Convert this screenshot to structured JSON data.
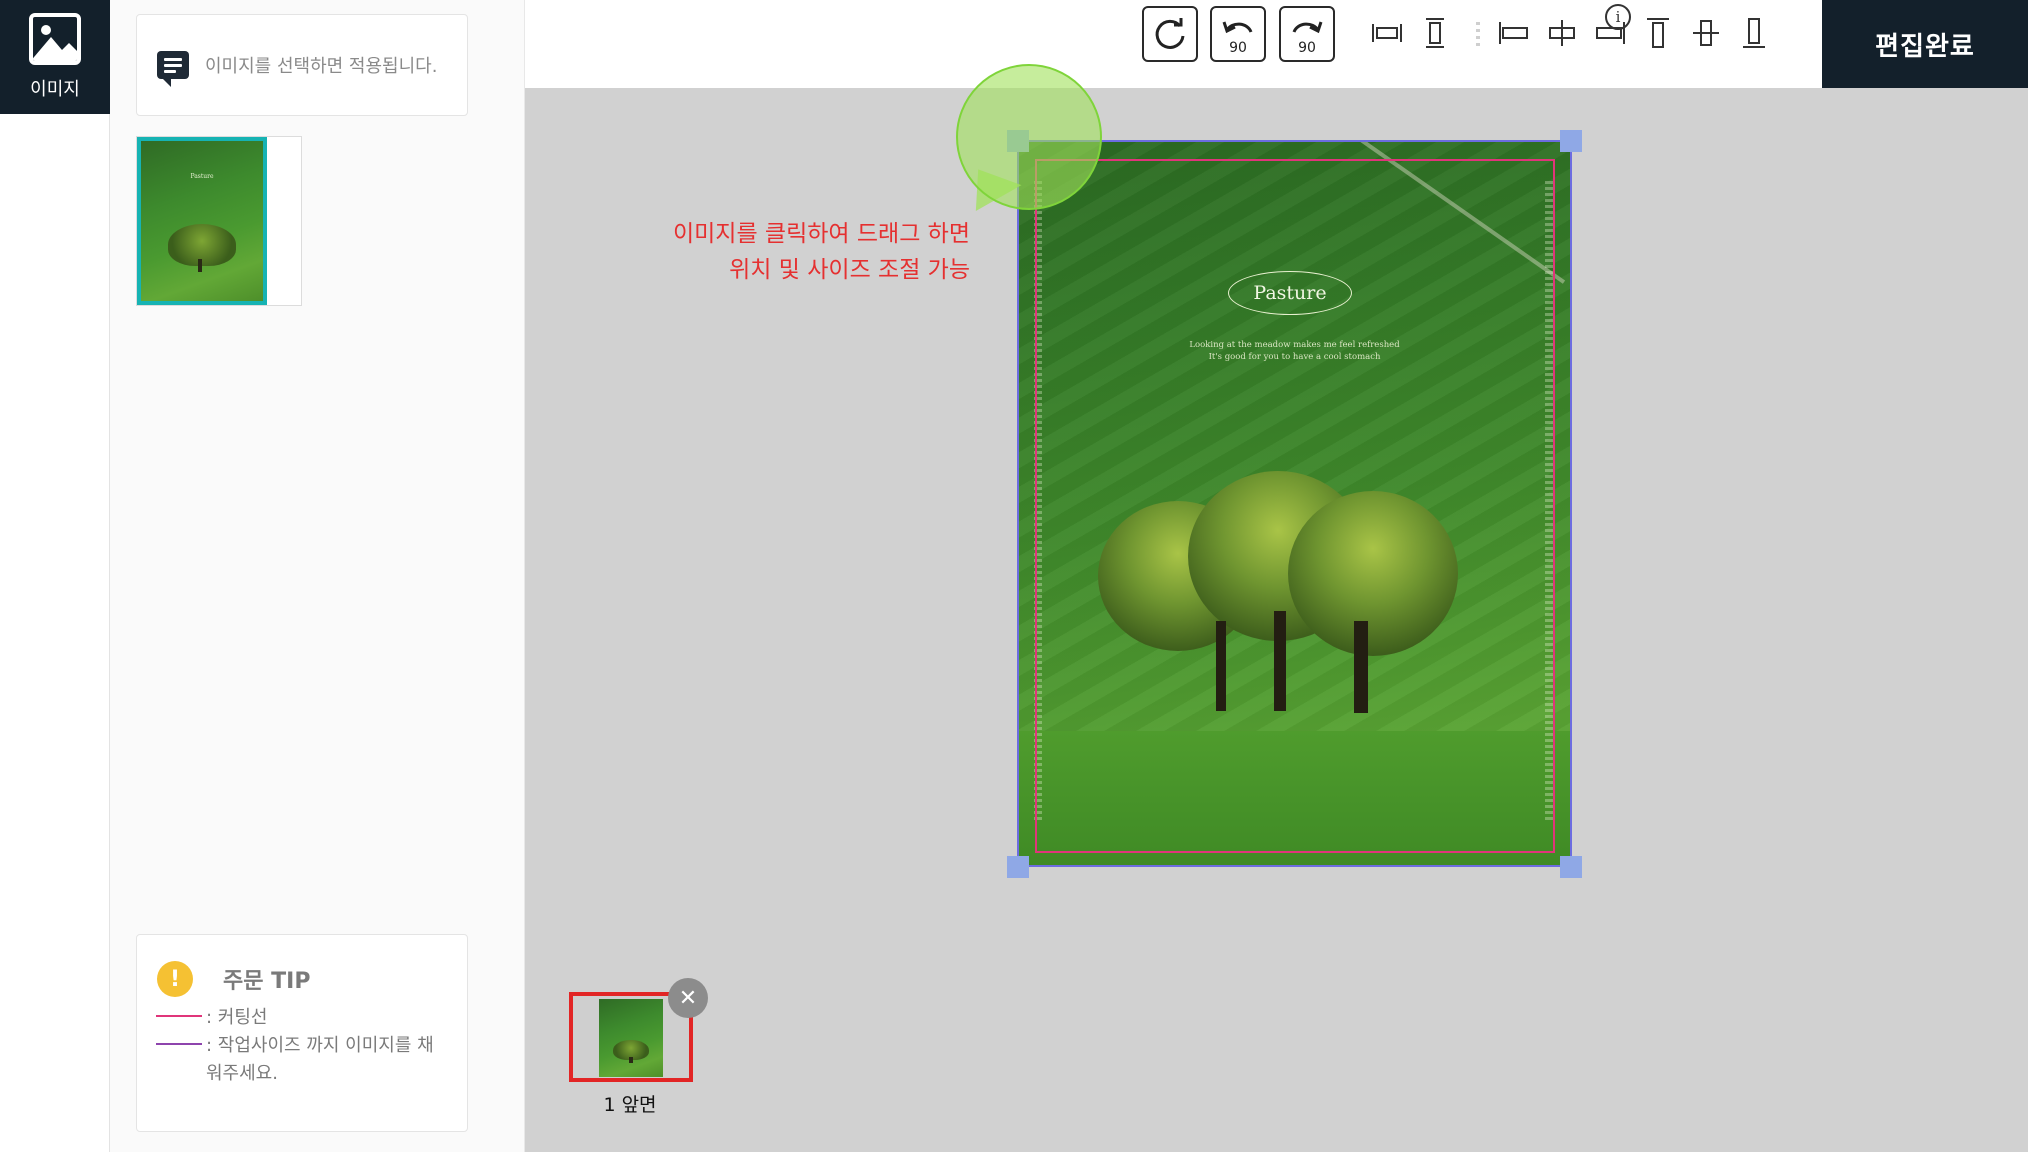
{
  "rail": {
    "image_tab_label": "이미지"
  },
  "panel": {
    "hint_text": "이미지를 선택하면 적용됩니다.",
    "tip": {
      "title": "주문 TIP",
      "icon_glyph": "!",
      "line1": ": 커팅선",
      "line2": ": 작업사이즈 까지 이미지를 채워주세요.",
      "line1_color": "#e0357a",
      "line2_color": "#8e44ad"
    }
  },
  "toolbar": {
    "info_glyph": "i",
    "rotate_left_label": "90",
    "rotate_right_label": "90",
    "done_label": "편집완료"
  },
  "canvas": {
    "annotation_line1": "이미지를 클릭하여 드래그 하면",
    "annotation_line2": "위치 및 사이즈 조절 가능",
    "poster": {
      "title": "Pasture",
      "sub1": "Looking at the meadow makes me feel refreshed",
      "sub2": "It's good for you to have a cool stomach"
    },
    "page_thumb_label": "1 앞면",
    "page_close_glyph": "✕"
  },
  "colors": {
    "dark": "#13202b",
    "selected_border": "#16b3b3",
    "cut_line": "#e0357a",
    "work_line": "#6c6ce0",
    "annotation": "#e53030",
    "thumb_highlight": "#e22525"
  }
}
